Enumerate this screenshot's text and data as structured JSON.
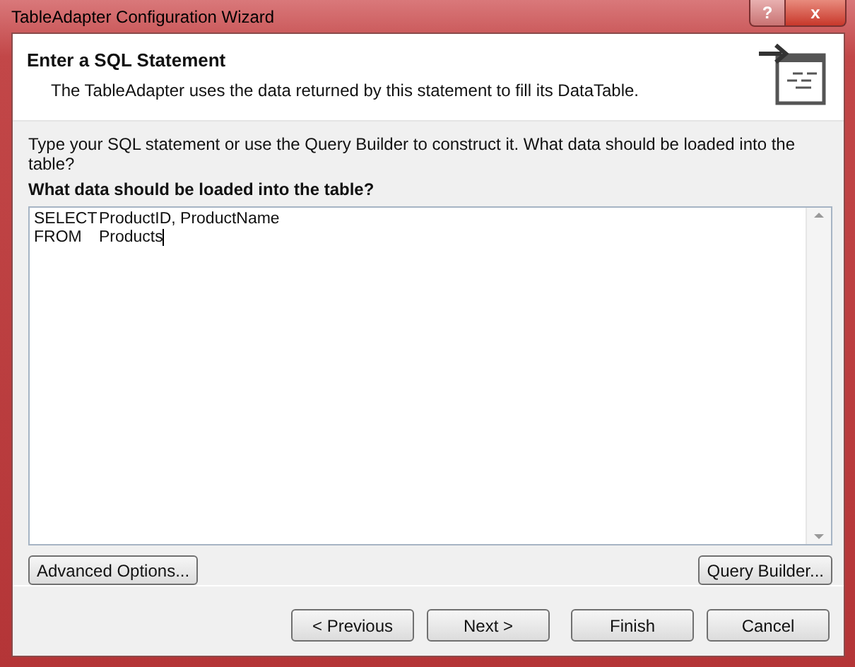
{
  "window": {
    "title": "TableAdapter Configuration Wizard",
    "help_glyph": "?",
    "close_glyph": "x"
  },
  "header": {
    "title": "Enter a SQL Statement",
    "subtitle": "The TableAdapter uses the data returned by this statement to fill its DataTable."
  },
  "instructions": "Type your SQL statement or use the Query Builder to construct it. What data should be loaded into the table?",
  "prompt": "What data should be loaded into the table?",
  "sql": {
    "lines": [
      {
        "keyword": "SELECT",
        "value": "ProductID, ProductName"
      },
      {
        "keyword": "FROM",
        "value": "Products"
      }
    ]
  },
  "option_buttons": [
    {
      "label": "Advanced Options..."
    },
    {
      "label": "Query Builder..."
    }
  ],
  "nav_buttons": [
    {
      "label": "< Previous"
    },
    {
      "label": "Next >"
    },
    {
      "label": "Finish"
    },
    {
      "label": "Cancel"
    }
  ]
}
